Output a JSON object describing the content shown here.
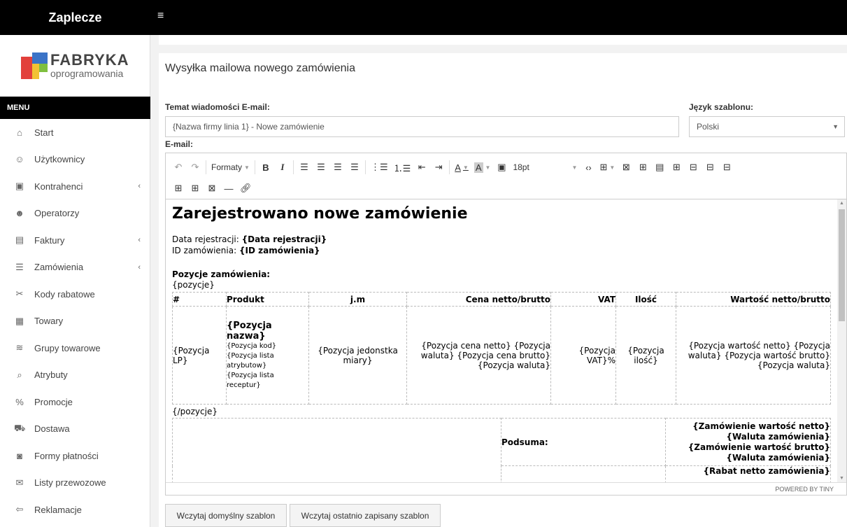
{
  "sidebar": {
    "brand": "Zaplecze",
    "logo": {
      "line1": "FABRYKA",
      "line2": "oprogramowania"
    },
    "menu_title": "MENU",
    "items": [
      {
        "label": "Start",
        "icon": "home-icon",
        "glyph": "⌂",
        "chevron": ""
      },
      {
        "label": "Użytkownicy",
        "icon": "users-icon",
        "glyph": "☺",
        "chevron": ""
      },
      {
        "label": "Kontrahenci",
        "icon": "contacts-icon",
        "glyph": "▣",
        "chevron": "‹"
      },
      {
        "label": "Operatorzy",
        "icon": "operators-icon",
        "glyph": "☻",
        "chevron": ""
      },
      {
        "label": "Faktury",
        "icon": "invoice-icon",
        "glyph": "▤",
        "chevron": "‹"
      },
      {
        "label": "Zamówienia",
        "icon": "list-icon",
        "glyph": "☰",
        "chevron": "‹"
      },
      {
        "label": "Kody rabatowe",
        "icon": "scissors-icon",
        "glyph": "✂",
        "chevron": ""
      },
      {
        "label": "Towary",
        "icon": "boxes-icon",
        "glyph": "▦",
        "chevron": ""
      },
      {
        "label": "Grupy towarowe",
        "icon": "layers-icon",
        "glyph": "≋",
        "chevron": ""
      },
      {
        "label": "Atrybuty",
        "icon": "tag-icon",
        "glyph": "⌕",
        "chevron": ""
      },
      {
        "label": "Promocje",
        "icon": "percent-icon",
        "glyph": "%",
        "chevron": ""
      },
      {
        "label": "Dostawa",
        "icon": "truck-icon",
        "glyph": "⛟",
        "chevron": ""
      },
      {
        "label": "Formy płatności",
        "icon": "money-icon",
        "glyph": "◙",
        "chevron": ""
      },
      {
        "label": "Listy przewozowe",
        "icon": "mail-icon",
        "glyph": "✉",
        "chevron": ""
      },
      {
        "label": "Reklamacje",
        "icon": "return-icon",
        "glyph": "⇦",
        "chevron": ""
      }
    ]
  },
  "topbar": {
    "menu_icon": "≡"
  },
  "page": {
    "title": "Wysyłka mailowa nowego zamówienia",
    "subject_label": "Temat wiadomości E-mail:",
    "subject_value": "{Nazwa firmy linia 1} - Nowe zamówienie",
    "language_label": "Język szablonu:",
    "language_value": "Polski",
    "email_label": "E-mail:"
  },
  "editor": {
    "toolbar": {
      "formats_label": "Formaty",
      "font_size": "18pt"
    },
    "status": "POWERED BY TINY",
    "content": {
      "heading": "Zarejestrowano nowe zamówienie",
      "reg_label": "Data rejestracji: ",
      "reg_value": "{Data rejestracji}",
      "id_label": "ID zamówienia: ",
      "id_value": "{ID zamówienia}",
      "positions_title": "Pozycje zamówienia:",
      "positions_open": "{pozycje}",
      "positions_close": "{/pozycje}",
      "headers": [
        "#",
        "Produkt",
        "j.m",
        "Cena netto/brutto",
        "VAT",
        "Ilość",
        "Wartość netto/brutto"
      ],
      "row": {
        "lp": "{Pozycja LP}",
        "name": "{Pozycja nazwa}",
        "code": "{Pozycja kod}",
        "attrs": "{Pozycja lista atrybutow}",
        "recipes": "{Pozycja lista receptur}",
        "unit": "{Pozycja jedonstka miary}",
        "price": "{Pozycja cena netto} {Pozycja waluta} {Pozycja cena brutto} {Pozycja waluta}",
        "vat": "{Pozycja VAT}%",
        "qty": "{Pozycja ilość}",
        "value": "{Pozycja wartość netto} {Pozycja waluta} {Pozycja wartość brutto} {Pozycja waluta}"
      },
      "summary_label": "Podsuma:",
      "summary_l1": "{Zamówienie wartość netto}",
      "summary_l2": "{Waluta zamówienia}",
      "summary_l3": "{Zamówienie wartość brutto}",
      "summary_l4": "{Waluta zamówienia}",
      "summary_l5": "{Rabat netto zamówienia}"
    }
  },
  "buttons": {
    "load_default": "Wczytaj domyślny szablon",
    "load_last": "Wczytaj ostatnio zapisany szablon"
  },
  "colors": {
    "topbar": "#000000",
    "logo_red": "#e2403b",
    "logo_blue": "#3b73c7",
    "logo_yellow": "#f2c233",
    "logo_green": "#7fbf3f"
  }
}
